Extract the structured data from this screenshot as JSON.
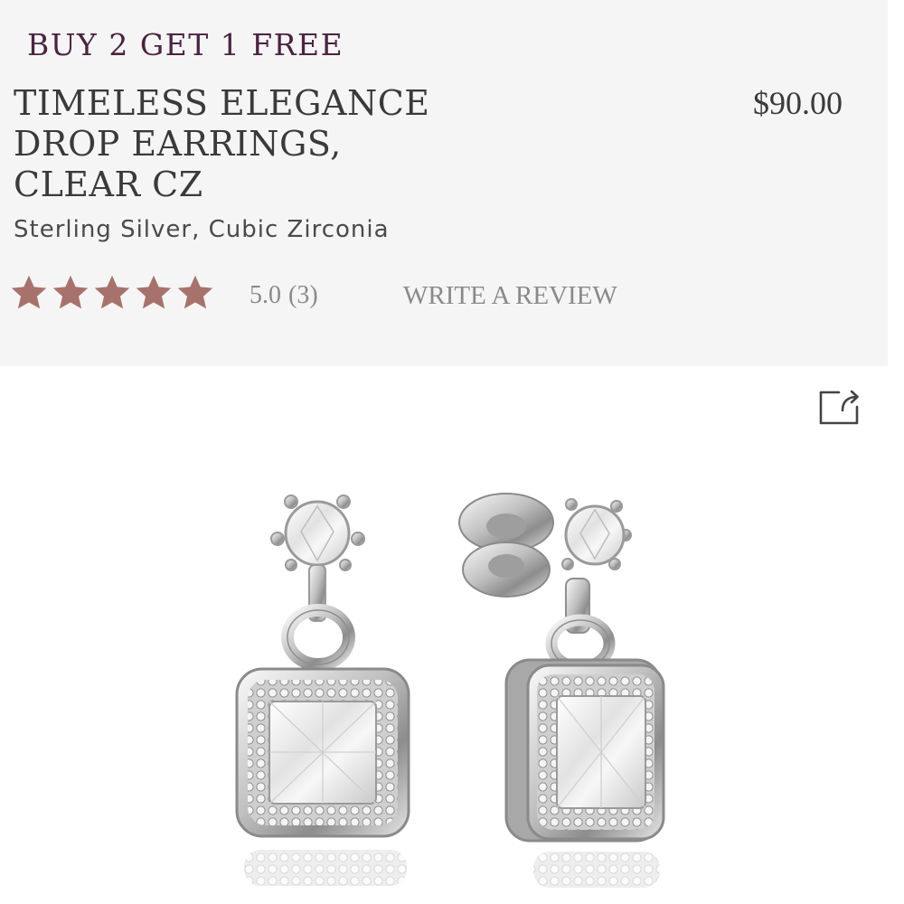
{
  "promo": {
    "text": "BUY 2 GET 1 FREE",
    "color": "#4a2340"
  },
  "product": {
    "title_lines": [
      "TIMELESS ELEGANCE",
      "DROP EARRINGS,",
      "CLEAR CZ"
    ],
    "price": "$90.00",
    "material": "Sterling Silver, Cubic Zirconia"
  },
  "rating": {
    "stars": 5,
    "max_stars": 5,
    "value": "5.0",
    "count": "(3)",
    "star_color": "#a8726c",
    "write_review_label": "WRITE A REVIEW"
  },
  "share": {
    "icon": "share-icon"
  },
  "image": {
    "subject": "product-photo"
  }
}
